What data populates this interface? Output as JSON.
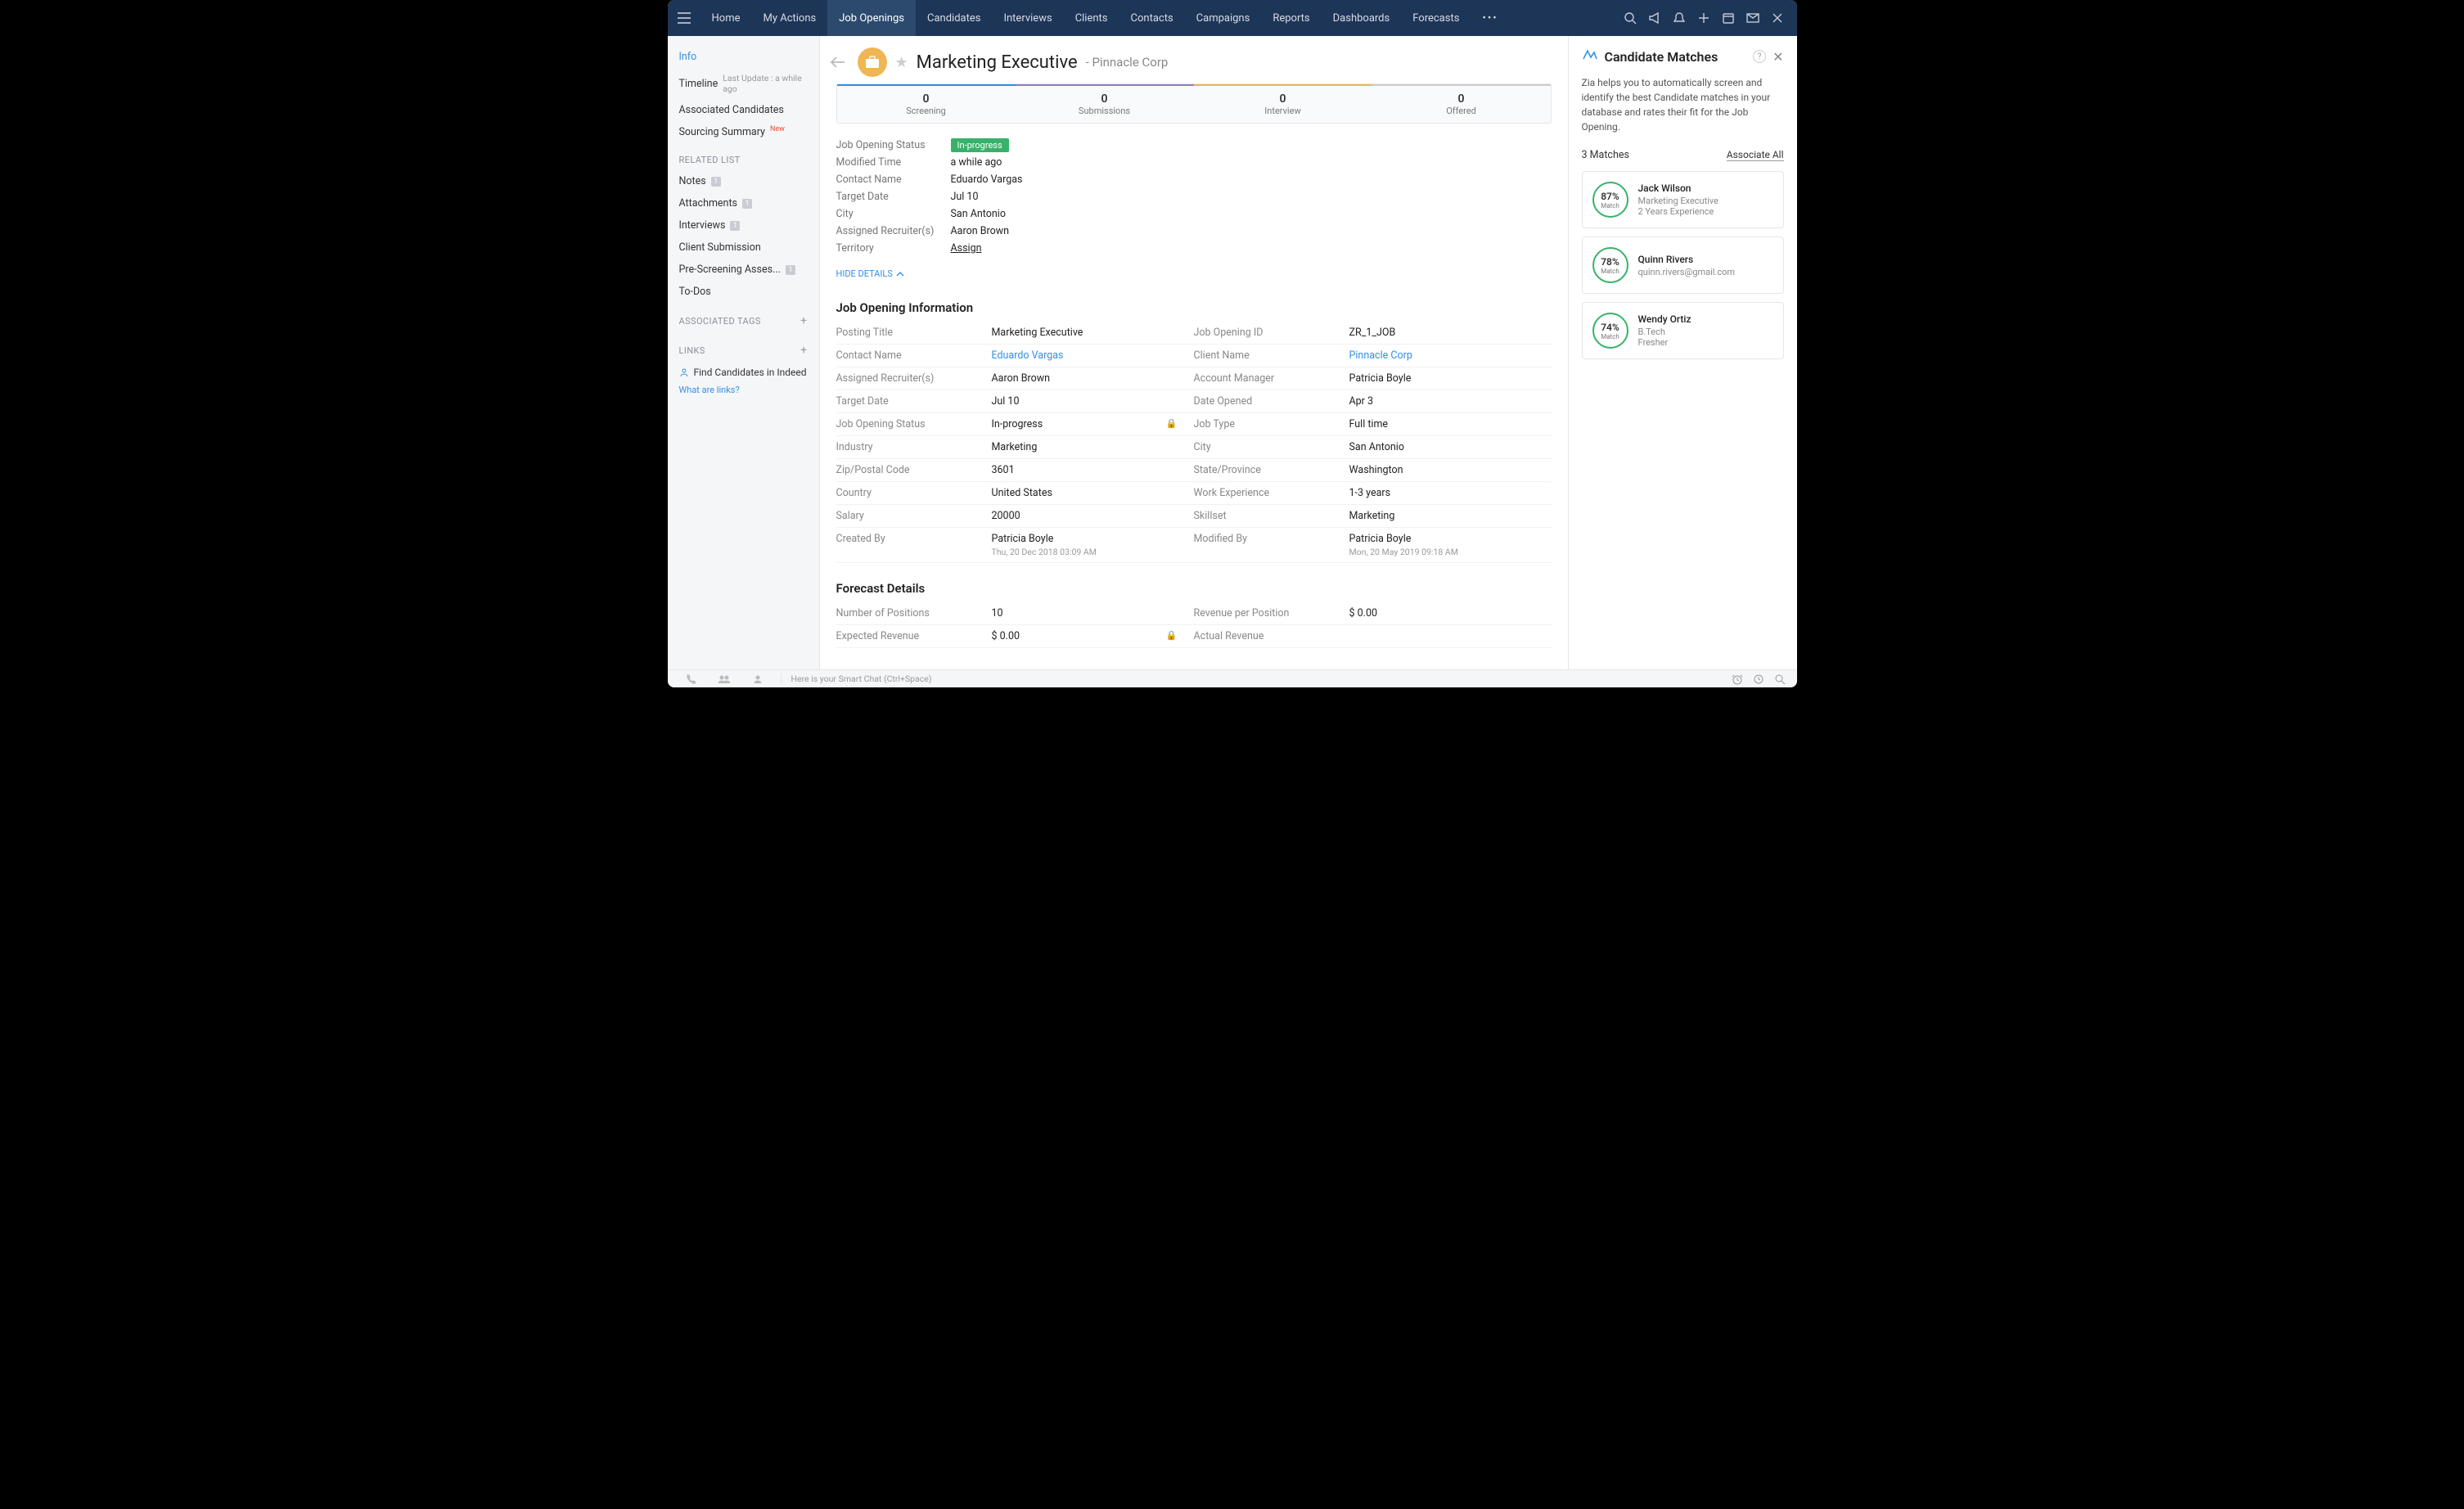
{
  "nav": {
    "tabs": [
      "Home",
      "My Actions",
      "Job Openings",
      "Candidates",
      "Interviews",
      "Clients",
      "Contacts",
      "Campaigns",
      "Reports",
      "Dashboards",
      "Forecasts"
    ],
    "active": 2
  },
  "sidebar": {
    "main": [
      {
        "label": "Info",
        "selected": true
      },
      {
        "label": "Timeline",
        "sub": "Last Update : a while ago"
      },
      {
        "label": "Associated Candidates"
      },
      {
        "label": "Sourcing Summary",
        "new": true
      }
    ],
    "related_header": "RELATED LIST",
    "related": [
      {
        "label": "Notes",
        "badge": "1"
      },
      {
        "label": "Attachments",
        "badge": "1"
      },
      {
        "label": "Interviews",
        "badge": "1"
      },
      {
        "label": "Client Submission"
      },
      {
        "label": "Pre-Screening Asses...",
        "badge": "1"
      },
      {
        "label": "To-Dos"
      }
    ],
    "tags_header": "ASSOCIATED TAGS",
    "links_header": "LINKS",
    "find_link": "Find Candidates in Indeed",
    "links_help": "What are links?"
  },
  "header": {
    "title": "Marketing Executive",
    "subtitle": "- Pinnacle Corp"
  },
  "pipeline": [
    {
      "num": "0",
      "label": "Screening"
    },
    {
      "num": "0",
      "label": "Submissions"
    },
    {
      "num": "0",
      "label": "Interview"
    },
    {
      "num": "0",
      "label": "Offered"
    }
  ],
  "summary": {
    "rows": [
      {
        "label": "Job Opening Status",
        "val": "In-progress",
        "badge": true
      },
      {
        "label": "Modified Time",
        "val": "a while ago"
      },
      {
        "label": "Contact Name",
        "val": "Eduardo Vargas"
      },
      {
        "label": "Target Date",
        "val": "Jul 10"
      },
      {
        "label": "City",
        "val": "San Antonio"
      },
      {
        "label": "Assigned Recruiter(s)",
        "val": "Aaron Brown"
      },
      {
        "label": "Territory",
        "val": "Assign",
        "assign": true
      }
    ],
    "hide": "HIDE DETAILS"
  },
  "section1_title": "Job Opening Information",
  "info_left": [
    {
      "label": "Posting Title",
      "val": "Marketing Executive"
    },
    {
      "label": "Contact Name",
      "val": "Eduardo Vargas",
      "link": true
    },
    {
      "label": "Assigned Recruiter(s)",
      "val": "Aaron Brown"
    },
    {
      "label": "Target Date",
      "val": "Jul 10"
    },
    {
      "label": "Job Opening Status",
      "val": "In-progress",
      "lock": true
    },
    {
      "label": "Industry",
      "val": "Marketing"
    },
    {
      "label": "Zip/Postal Code",
      "val": "3601"
    },
    {
      "label": "Country",
      "val": "United States"
    },
    {
      "label": "Salary",
      "val": "20000"
    },
    {
      "label": "Created By",
      "val": "Patricia Boyle",
      "sub": "Thu, 20 Dec 2018 03:09 AM"
    }
  ],
  "info_right": [
    {
      "label": "Job Opening ID",
      "val": "ZR_1_JOB"
    },
    {
      "label": "Client Name",
      "val": "Pinnacle Corp",
      "link": true
    },
    {
      "label": "Account Manager",
      "val": "Patricia Boyle"
    },
    {
      "label": "Date Opened",
      "val": "Apr 3"
    },
    {
      "label": "Job Type",
      "val": "Full time"
    },
    {
      "label": "City",
      "val": "San Antonio"
    },
    {
      "label": "State/Province",
      "val": "Washington"
    },
    {
      "label": "Work Experience",
      "val": "1-3 years"
    },
    {
      "label": "Skillset",
      "val": "Marketing"
    },
    {
      "label": "Modified By",
      "val": "Patricia Boyle",
      "sub": "Mon, 20 May 2019 09:18 AM"
    }
  ],
  "section2_title": "Forecast Details",
  "forecast_left": [
    {
      "label": "Number of Positions",
      "val": "10"
    },
    {
      "label": "Expected Revenue",
      "val": "$ 0.00",
      "lock": true
    }
  ],
  "forecast_right": [
    {
      "label": "Revenue per Position",
      "val": "$ 0.00"
    },
    {
      "label": "Actual Revenue",
      "val": ""
    }
  ],
  "rightpanel": {
    "title": "Candidate Matches",
    "desc": "Zia helps you to automatically screen and identify the best Candidate matches in your database and rates their fit for the Job Opening.",
    "count": "3 Matches",
    "assoc": "Associate All",
    "match_label": "Match",
    "matches": [
      {
        "pct": "87%",
        "name": "Jack Wilson",
        "line1": "Marketing Executive",
        "line2": "2 Years Experience"
      },
      {
        "pct": "78%",
        "name": "Quinn Rivers",
        "line1": "quinn.rivers@gmail.com",
        "line2": ""
      },
      {
        "pct": "74%",
        "name": "Wendy Ortiz",
        "line1": "B.Tech",
        "line2": "Fresher"
      }
    ]
  },
  "footer": {
    "chat": "Here is your Smart Chat (Ctrl+Space)"
  }
}
